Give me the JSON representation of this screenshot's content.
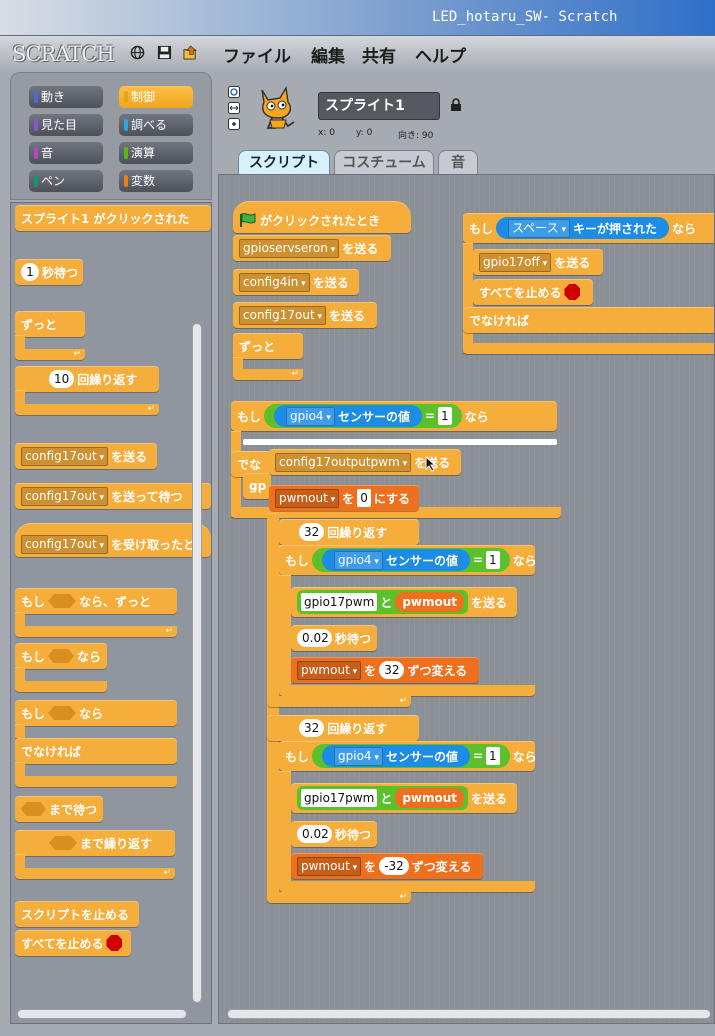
{
  "window": {
    "title": "LED_hotaru_SW- Scratch"
  },
  "menubar": {
    "logo": "SCRATCH",
    "items": [
      "ファイル",
      "編集",
      "共有",
      "ヘルプ"
    ]
  },
  "categories": [
    {
      "label": "動き",
      "color": "#4a6cd4"
    },
    {
      "label": "制御",
      "color": "#e1a91a",
      "selected": true
    },
    {
      "label": "見た目",
      "color": "#8a55d7"
    },
    {
      "label": "調べる",
      "color": "#2ca5e2"
    },
    {
      "label": "音",
      "color": "#bb42c3"
    },
    {
      "label": "演算",
      "color": "#5cb712"
    },
    {
      "label": "ペン",
      "color": "#0e9a6c"
    },
    {
      "label": "変数",
      "color": "#ee7d16"
    }
  ],
  "palette": {
    "sprite_click_hat": "スプライト1 がクリックされた",
    "wait": {
      "num": "1",
      "label": "秒待つ"
    },
    "forever": "ずっと",
    "repeat": {
      "num": "10",
      "label": "回繰り返す"
    },
    "broadcast": {
      "msg": "config17out",
      "label": "を送る"
    },
    "broadcast_wait": {
      "msg": "config17out",
      "label": "を送って待つ"
    },
    "receive_hat": {
      "msg": "config17out",
      "label": "を受け取ったと"
    },
    "if_forever": {
      "if": "もし",
      "label": "なら、ずっと"
    },
    "if_then": {
      "if": "もし",
      "label": "なら"
    },
    "if_else": {
      "if": "もし",
      "label": "なら",
      "else": "でなければ"
    },
    "wait_until": "まで待つ",
    "repeat_until": "まで繰り返す",
    "stop_script": "スクリプトを止める",
    "stop_all": "すべてを止める"
  },
  "sprite": {
    "name": "スプライト1",
    "x_label": "x: 0",
    "y_label": "y: 0",
    "dir_label": "向き: 90"
  },
  "tabs": [
    "スクリプト",
    "コスチューム",
    "音"
  ],
  "script1": {
    "hat": "がクリックされたとき",
    "b1": {
      "msg": "gpioservseron",
      "label": "を送る"
    },
    "b2": {
      "msg": "config4in",
      "label": "を送る"
    },
    "b3": {
      "msg": "config17out",
      "label": "を送る"
    },
    "forever": "ずっと"
  },
  "script2": {
    "if": "もし",
    "key": "スペース",
    "key_label": "キーが押された",
    "then": "なら",
    "b1": {
      "msg": "gpio17off",
      "label": "を送る"
    },
    "stop_all": "すべてを止める",
    "else": "でなければ"
  },
  "script3": {
    "if": "もし",
    "sensor": "gpio4",
    "sensor_label": "センサーの値",
    "eq": "=",
    "eq_val": "1",
    "then": "なら",
    "else_partial": "でな",
    "hidden_partial": "gp",
    "drag_block": {
      "msg": "config17outputpwm",
      "label": "を送る"
    },
    "set_var": {
      "var": "pwmout",
      "label": "を",
      "val": "0",
      "suffix": "にする"
    },
    "loop1": {
      "repeat_num": "32",
      "repeat_label": "回繰り返す",
      "if": "もし",
      "sensor": "gpio4",
      "sensor_label": "センサーの値",
      "eq": "=",
      "eq_val": "1",
      "then": "なら",
      "join_left": "gpio17pwm",
      "join": "と",
      "join_var": "pwmout",
      "send": "を送る",
      "wait_num": "0.02",
      "wait_label": "秒待つ",
      "change_var": "pwmout",
      "change_label": "を",
      "change_num": "32",
      "change_suffix": "ずつ変える"
    },
    "loop2": {
      "repeat_num": "32",
      "repeat_label": "回繰り返す",
      "if": "もし",
      "sensor": "gpio4",
      "sensor_label": "センサーの値",
      "eq": "=",
      "eq_val": "1",
      "then": "なら",
      "join_left": "gpio17pwm",
      "join": "と",
      "join_var": "pwmout",
      "send": "を送る",
      "wait_num": "0.02",
      "wait_label": "秒待つ",
      "change_var": "pwmout",
      "change_label": "を",
      "change_num": "-32",
      "change_suffix": "ずつ変える"
    }
  }
}
